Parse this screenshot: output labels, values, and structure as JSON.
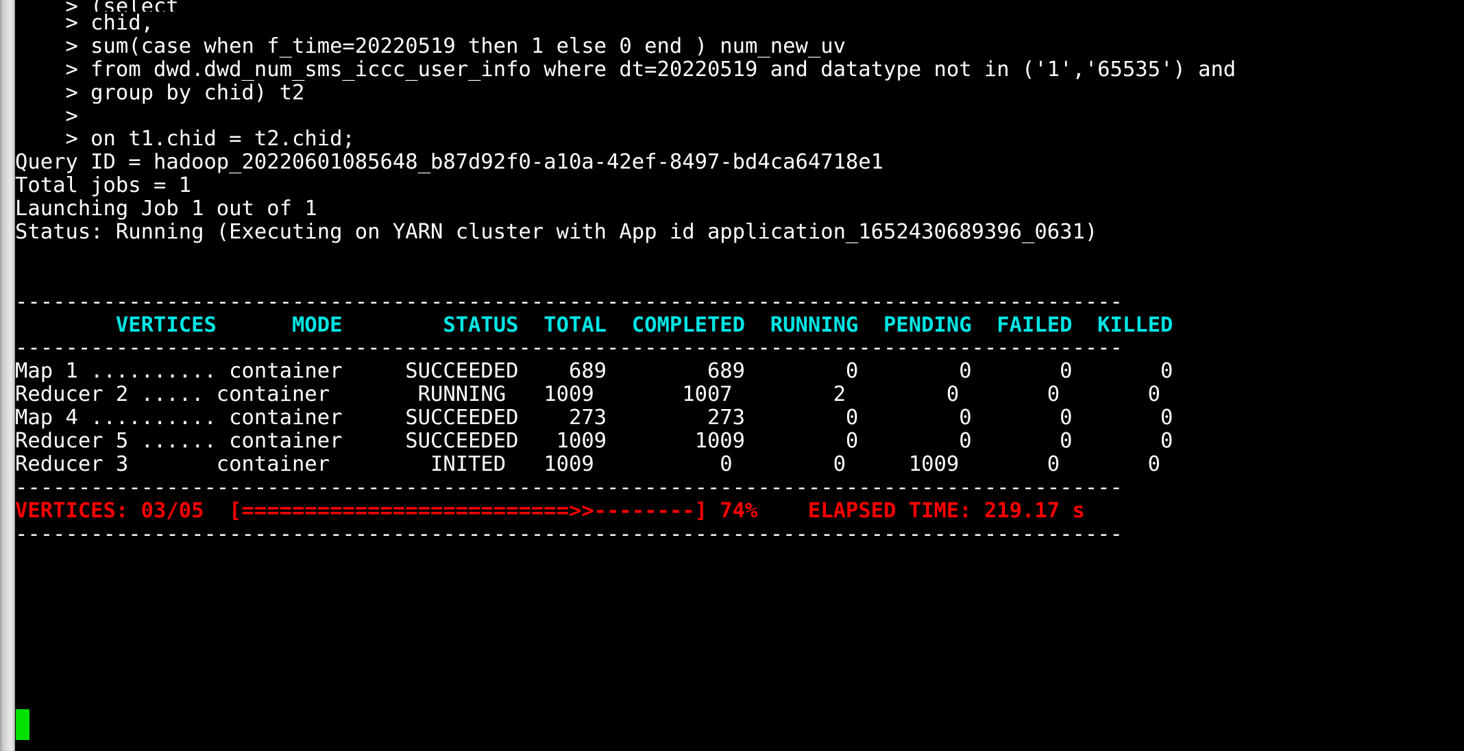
{
  "terminal": {
    "colors": {
      "background": "#000000",
      "text": "#ffffff",
      "header": "#00e5e5",
      "progress": "#ff0000",
      "cursor": "#00e000",
      "scrollbar": "#dcdcdc"
    },
    "prompt": ">"
  },
  "sql": {
    "lines": [
      "    > (select",
      "    > chid,",
      "    > sum(case when f_time=20220519 then 1 else 0 end ) num_new_uv",
      "    > from dwd.dwd_num_sms_iccc_user_info where dt=20220519 and datatype not in ('1','65535') and",
      "    > group by chid) t2",
      "    >",
      "    > on t1.chid = t2.chid;"
    ]
  },
  "job_info": {
    "query_id": "Query ID = hadoop_20220601085648_b87d92f0-a10a-42ef-8497-bd4ca64718e1",
    "total_jobs": "Total jobs = 1",
    "launching": "Launching Job 1 out of 1",
    "status": "Status: Running (Executing on YARN cluster with App id application_1652430689396_0631)"
  },
  "vertices_table": {
    "separator": "----------------------------------------------------------------------------------------",
    "headers": [
      "VERTICES",
      "MODE",
      "STATUS",
      "TOTAL",
      "COMPLETED",
      "RUNNING",
      "PENDING",
      "FAILED",
      "KILLED"
    ],
    "header_line": "        VERTICES      MODE        STATUS  TOTAL  COMPLETED  RUNNING  PENDING  FAILED  KILLED",
    "rows": [
      {
        "line": "Map 1 .......... container     SUCCEEDED    689        689        0        0       0       0",
        "vertex": "Map 1 ..........",
        "mode": "container",
        "status": "SUCCEEDED",
        "total": "689",
        "completed": "689",
        "running": "0",
        "pending": "0",
        "failed": "0",
        "killed": "0"
      },
      {
        "line": "Reducer 2 ..... container       RUNNING   1009       1007        2        0       0       0",
        "vertex": "Reducer 2 .....",
        "mode": "container",
        "status": "RUNNING",
        "total": "1009",
        "completed": "1007",
        "running": "2",
        "pending": "0",
        "failed": "0",
        "killed": "0"
      },
      {
        "line": "Map 4 .......... container     SUCCEEDED    273        273        0        0       0       0",
        "vertex": "Map 4 ..........",
        "mode": "container",
        "status": "SUCCEEDED",
        "total": "273",
        "completed": "273",
        "running": "0",
        "pending": "0",
        "failed": "0",
        "killed": "0"
      },
      {
        "line": "Reducer 5 ...... container     SUCCEEDED   1009       1009        0        0       0       0",
        "vertex": "Reducer 5 ......",
        "mode": "container",
        "status": "SUCCEEDED",
        "total": "1009",
        "completed": "1009",
        "running": "0",
        "pending": "0",
        "failed": "0",
        "killed": "0"
      },
      {
        "line": "Reducer 3       container        INITED   1009          0        0     1009       0       0",
        "vertex": "Reducer 3",
        "mode": "container",
        "status": "INITED",
        "total": "1009",
        "completed": "0",
        "running": "0",
        "pending": "1009",
        "failed": "0",
        "killed": "0"
      }
    ]
  },
  "progress": {
    "line": "VERTICES: 03/05  [==========================>>--------] 74%    ELAPSED TIME: 219.17 s",
    "vertices_label": "VERTICES: 03/05",
    "bar": "[==========================>>--------]",
    "percent": "74%",
    "elapsed_label": "ELAPSED TIME:",
    "elapsed_value": "219.17 s",
    "completed_vertices": 3,
    "total_vertices": 5,
    "percent_value": 74,
    "elapsed_seconds": 219.17
  }
}
